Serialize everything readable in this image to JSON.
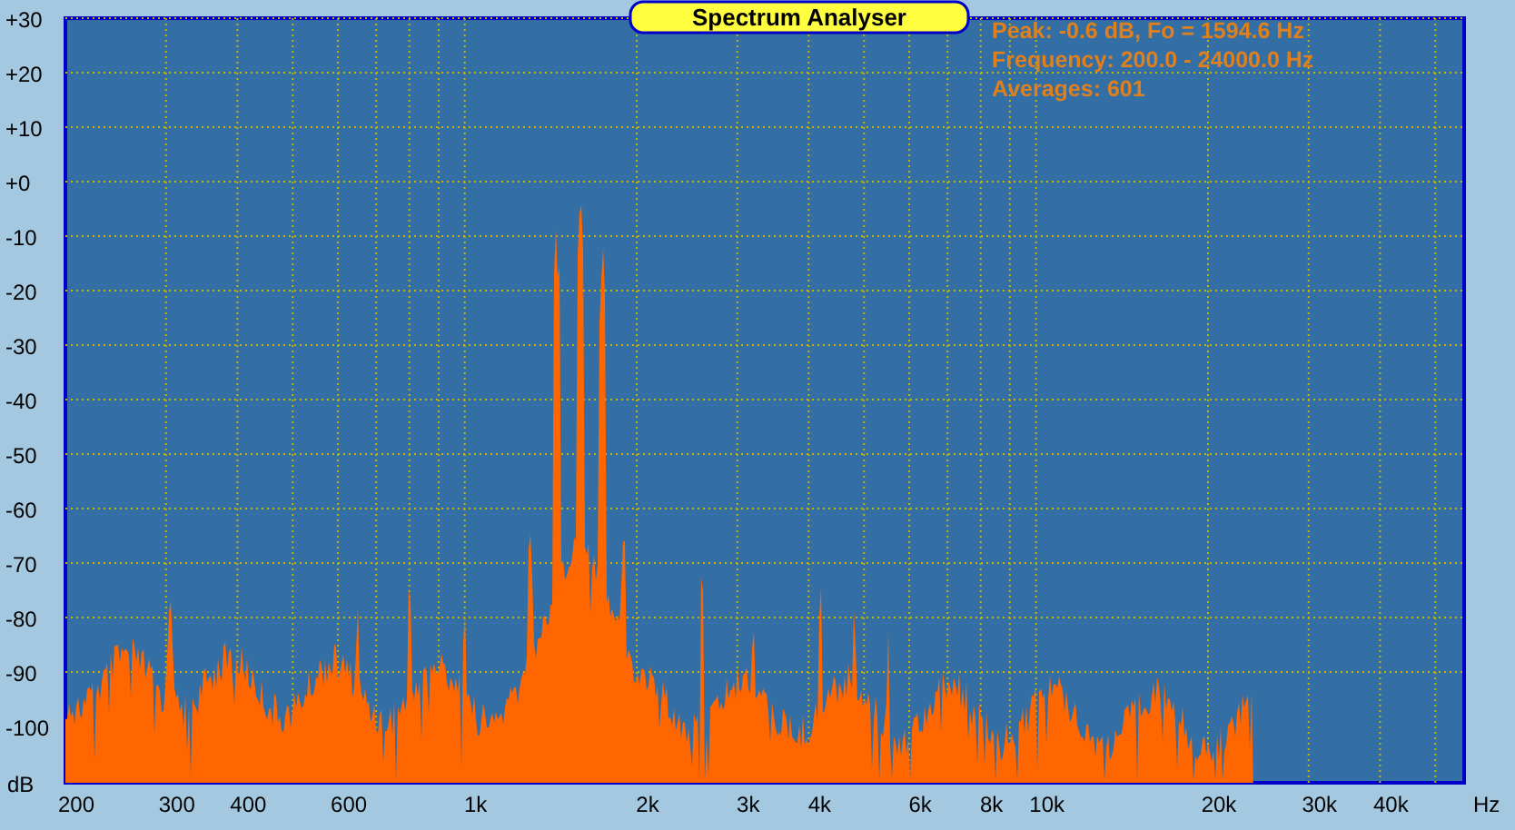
{
  "title": "Spectrum Analyser",
  "readouts": [
    "Peak: -0.6 dB, Fo = 1594.6 Hz",
    "Frequency: 200.0 - 24000.0 Hz",
    "Averages: 601"
  ],
  "y_axis": {
    "unit": "dB",
    "ticks": [
      "+30",
      "+20",
      "+10",
      "+0",
      "-10",
      "-20",
      "-30",
      "-40",
      "-50",
      "-60",
      "-70",
      "-80",
      "-90",
      "-100"
    ]
  },
  "x_axis": {
    "unit": "Hz",
    "ticks": [
      "200",
      "300",
      "400",
      "600",
      "1k",
      "2k",
      "3k",
      "4k",
      "6k",
      "8k",
      "10k",
      "20k",
      "30k",
      "40k"
    ]
  }
}
